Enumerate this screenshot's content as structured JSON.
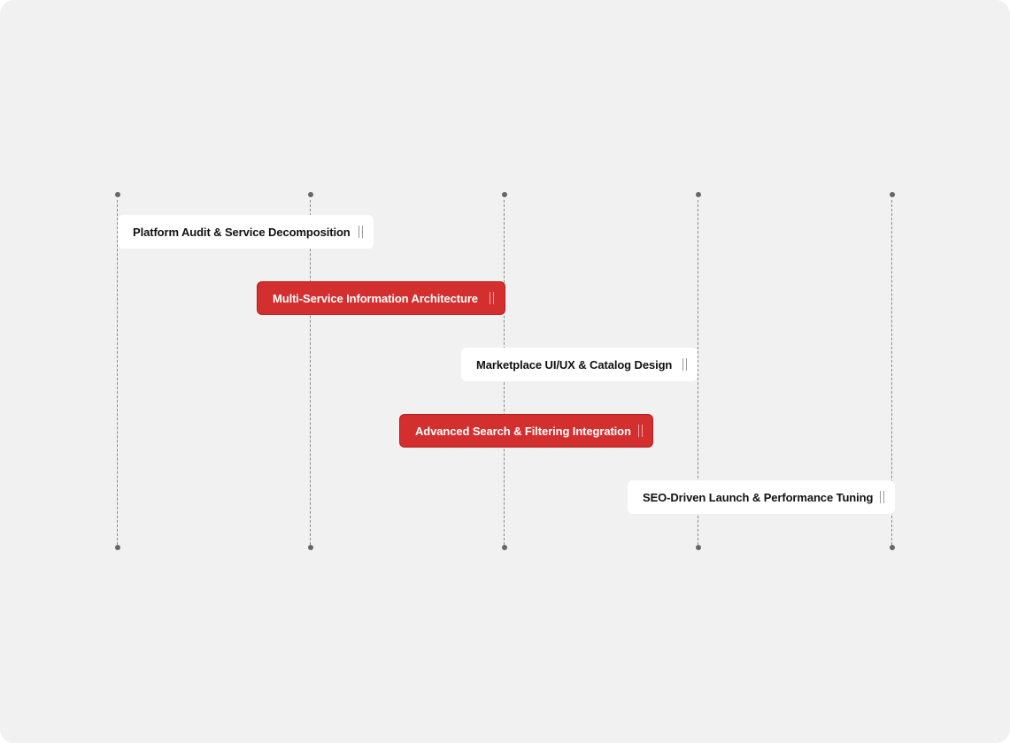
{
  "timeline": {
    "column_count": 5,
    "tasks": [
      {
        "label": "Platform Audit & Service Decomposition",
        "style": "light",
        "handle_icon": "drag-handle-icon"
      },
      {
        "label": "Multi-Service Information Architecture",
        "style": "accent",
        "handle_icon": "drag-handle-icon"
      },
      {
        "label": "Marketplace UI/UX & Catalog Design",
        "style": "light",
        "handle_icon": "drag-handle-icon"
      },
      {
        "label": "Advanced Search & Filtering Integration",
        "style": "accent",
        "handle_icon": "drag-handle-icon"
      },
      {
        "label": "SEO-Driven Launch & Performance Tuning",
        "style": "light",
        "handle_icon": "drag-handle-icon"
      }
    ]
  },
  "colors": {
    "background": "#f1f1f1",
    "card": "#ffffff",
    "accent": "#d32f2f",
    "guide_line": "#8a8a8a",
    "dot": "#666666"
  }
}
